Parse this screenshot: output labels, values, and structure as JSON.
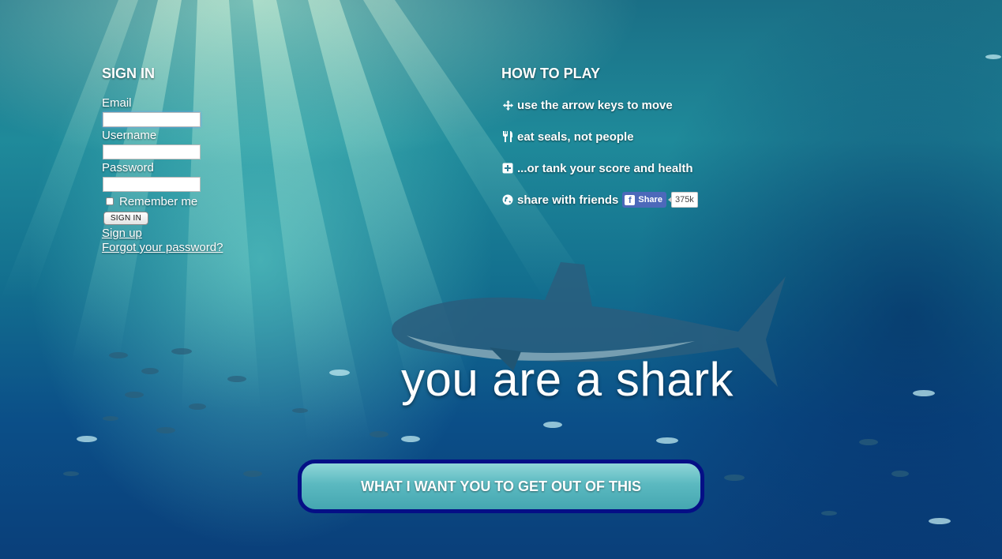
{
  "signin": {
    "title": "SIGN IN",
    "email_label": "Email",
    "username_label": "Username",
    "password_label": "Password",
    "remember_label": "Remember me",
    "submit_label": "SIGN IN",
    "signup_link": "Sign up",
    "forgot_link": "Forgot your password?"
  },
  "howto": {
    "title": "HOW TO PLAY",
    "items": [
      {
        "icon": "move-arrows-icon",
        "text": "use the arrow keys to move"
      },
      {
        "icon": "fork-knife-icon",
        "text": "eat seals, not people"
      },
      {
        "icon": "plus-box-icon",
        "text": "...or tank your score and health"
      },
      {
        "icon": "globe-icon",
        "text": "share with friends"
      }
    ],
    "share_button": "Share",
    "share_count": "375k"
  },
  "tagline": "you are a shark",
  "cta_label": "WHAT I WANT YOU TO GET OUT OF THIS",
  "colors": {
    "cta_border": "#050f86",
    "facebook_blue": "#4c69ba",
    "water_deep": "#0a3f7a",
    "water_light": "#1f8a9a"
  }
}
